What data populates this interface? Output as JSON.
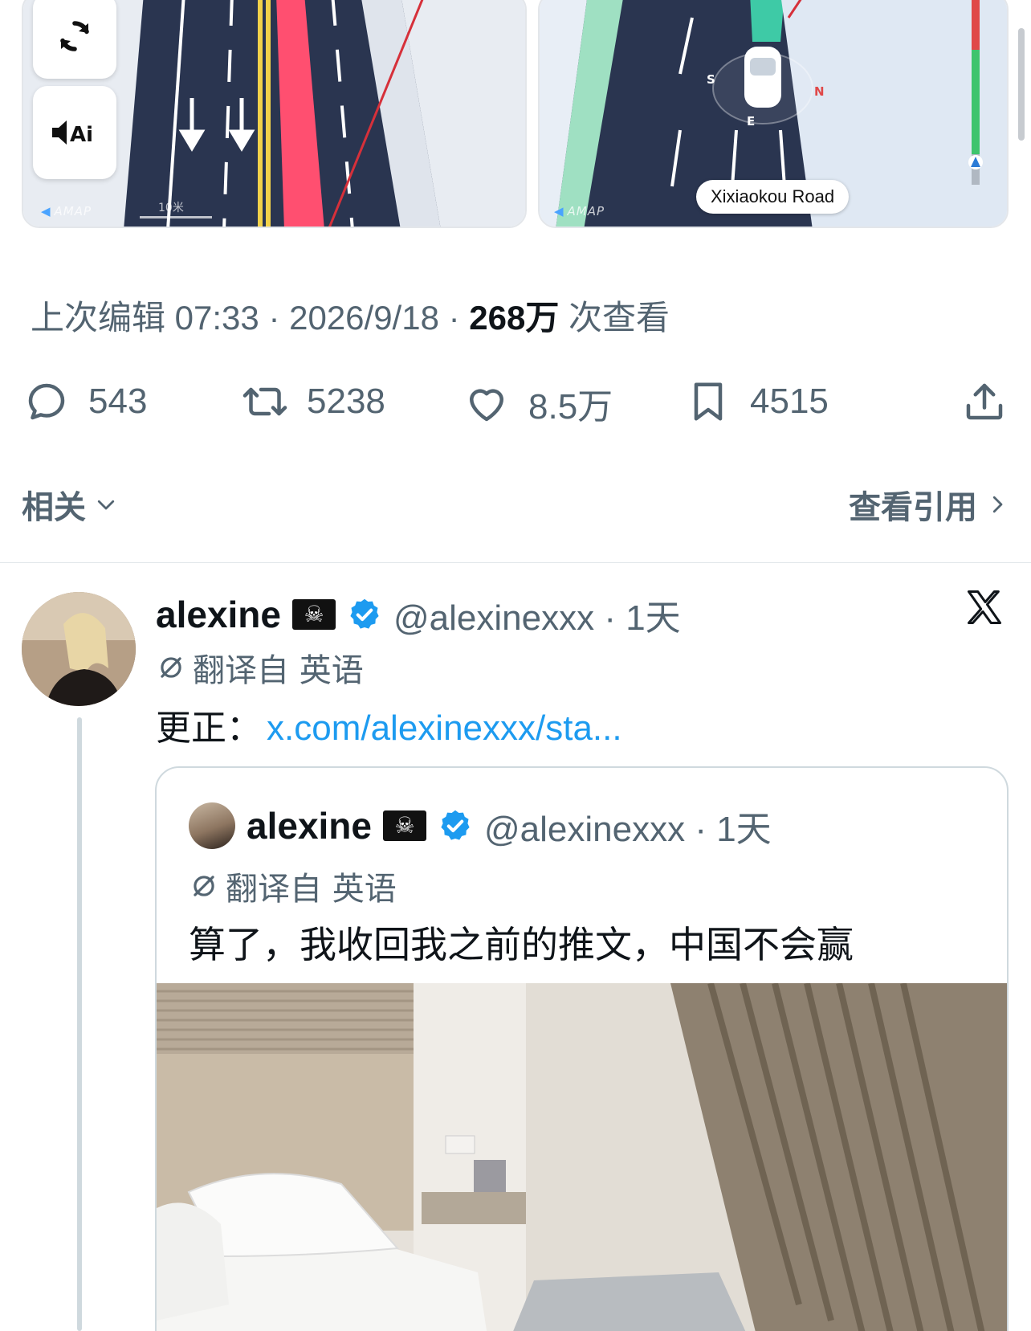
{
  "map_left": {
    "amap_label": "AMAP",
    "scale_label": "10米"
  },
  "map_right": {
    "amap_label": "AMAP",
    "road_name": "Xixiaokou Road",
    "compass": {
      "s": "S",
      "n": "N",
      "e": "E"
    }
  },
  "tweet_meta": {
    "edited_prefix": "上次编辑 07:33 · 2026/9/18 ·",
    "views_count": "268万",
    "views_suffix": "次查看"
  },
  "actions": {
    "replies": "543",
    "retweets": "5238",
    "likes": "8.5万",
    "bookmarks": "4515"
  },
  "related": {
    "left_label": "相关",
    "right_label": "查看引用"
  },
  "reply_tweet": {
    "name": "alexine",
    "flag": "☠",
    "handle_time": "@alexinexxx · 1天",
    "translated_from": "翻译自 英语",
    "text_prefix": "更正：",
    "link_text": "x.com/alexinexxx/sta..."
  },
  "quoted_tweet": {
    "name": "alexine",
    "flag": "☠",
    "handle_time": "@alexinexxx · 1天",
    "translated_from": "翻译自 英语",
    "text": "算了，我收回我之前的推文，中国不会赢"
  },
  "colors": {
    "link": "#1d9bf0",
    "verified": "#1d9bf0",
    "secondary_text": "#536471",
    "map_road": "#2a3550"
  },
  "icons": [
    "refresh-icon",
    "voice-ai-icon",
    "reply-icon",
    "retweet-icon",
    "like-icon",
    "bookmark-icon",
    "share-icon",
    "chevron-down-icon",
    "chevron-right-icon",
    "verified-icon",
    "x-logo-icon",
    "translate-icon"
  ]
}
